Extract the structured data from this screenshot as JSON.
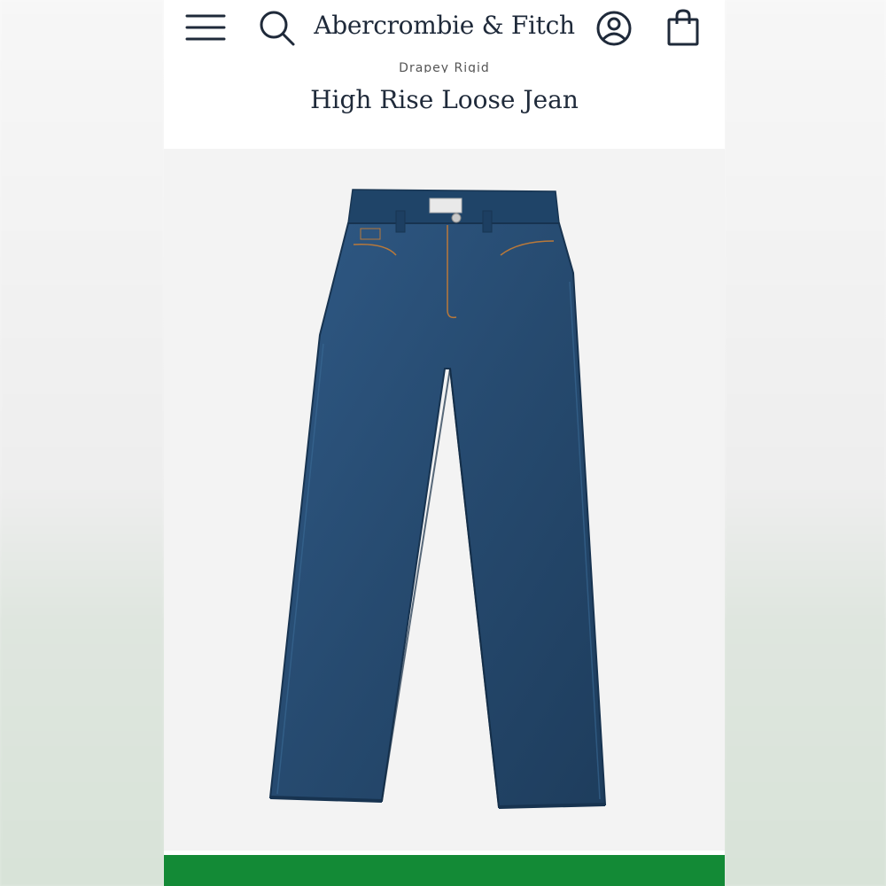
{
  "header": {
    "brand": "Abercrombie & Fitch",
    "icons": [
      "menu-icon",
      "search-icon",
      "account-icon",
      "shopping-bag-icon"
    ]
  },
  "product": {
    "category": "Drapey Rigid",
    "title": "High Rise Loose Jean",
    "image": "product-image-jeans"
  },
  "colors": {
    "text": "#1f2a3a",
    "denim": "#264a6f",
    "accent_bar": "#138a36"
  }
}
